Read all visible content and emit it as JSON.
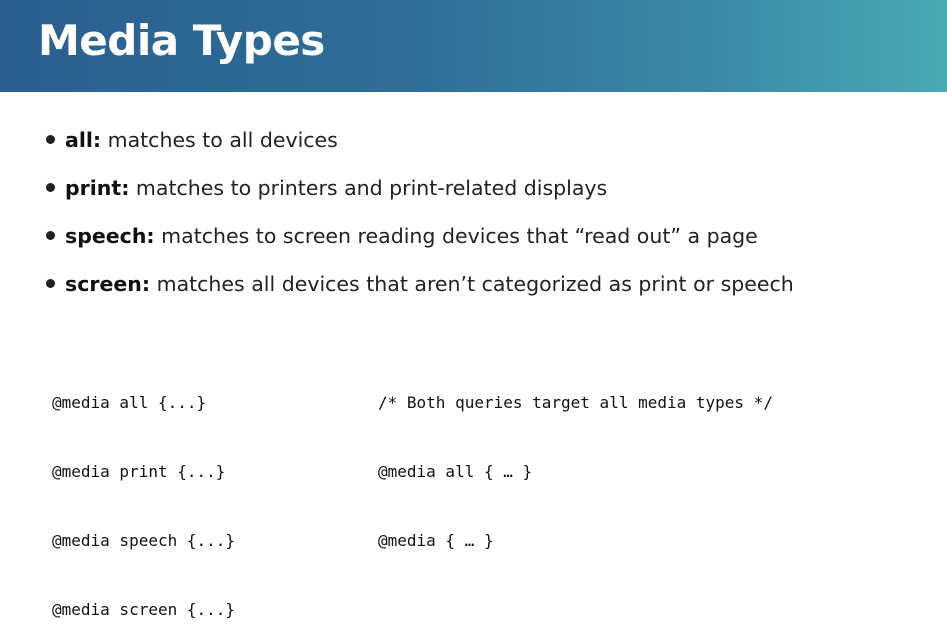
{
  "slide": {
    "title": "Media Types"
  },
  "bullets": [
    {
      "term": "all:",
      "text": " matches to all devices"
    },
    {
      "term": "print:",
      "text": " matches to printers and print-related displays"
    },
    {
      "term": "speech:",
      "text": " matches to screen reading devices that “read out” a page"
    },
    {
      "term": "screen:",
      "text": " matches all devices that aren’t categorized as print or speech"
    }
  ],
  "code_left": [
    "@media all {...}",
    "@media print {...}",
    "@media speech {...}",
    "@media screen {...}"
  ],
  "code_right": [
    "/* Both queries target all media types */",
    "@media all { … }",
    "@media { … }"
  ],
  "colors": {
    "header_gradient_start": "#2a5f8f",
    "header_gradient_end": "#4aa9b5",
    "title_text": "#ffffff",
    "body_text": "#222222"
  }
}
